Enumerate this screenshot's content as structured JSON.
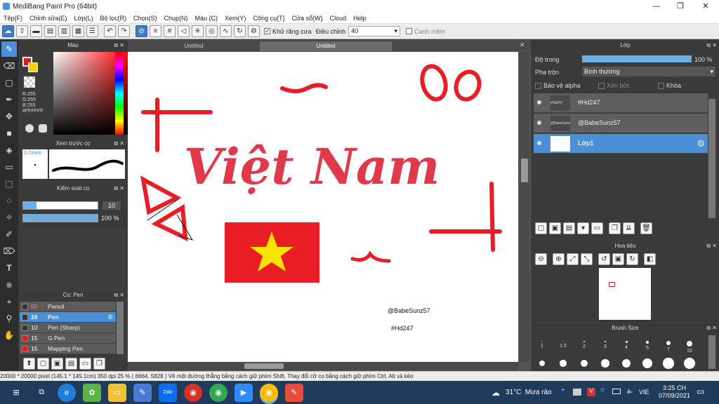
{
  "app": {
    "title": "MediBang Paint Pro (64bit)"
  },
  "menu": [
    "Tệp(F)",
    "Chỉnh sửa(E)",
    "Lớp(L)",
    "Bộ lọc(R)",
    "Chọn(S)",
    "Chụp(N)",
    "Màu (C)",
    "Xem(Y)",
    "Công cụ(T)",
    "Cửa sổ(W)",
    "Cloud",
    "Help"
  ],
  "toolbar": {
    "antialias_label": "Khử răng cưa",
    "adjust_label": "Điều chỉnh",
    "adjust_value": "40",
    "snap_label": "Canh mềm"
  },
  "color_panel": {
    "title": "Màu",
    "r": "R:255",
    "g": "G:255",
    "b": "B:255",
    "hex": "#FFFFFF",
    "primary": "#e8151b",
    "secondary": "#f5d300"
  },
  "brush_preview": {
    "title": "Xem trước cọ",
    "size": "0.73mm"
  },
  "brush_control": {
    "title": "Kiểm soát cọ",
    "size_value": "10",
    "opacity_value": "100 %"
  },
  "brush_list": {
    "title": "Cọ: Pen",
    "items": [
      {
        "size": "50",
        "name": "Pencil",
        "color": "#333333",
        "selected": false
      },
      {
        "size": "10",
        "name": "Pen",
        "color": "#333333",
        "selected": true
      },
      {
        "size": "10",
        "name": "Pen (Sharp)",
        "color": "#333333",
        "selected": false
      },
      {
        "size": "15",
        "name": "G Pen",
        "color": "#e8151b",
        "selected": false
      },
      {
        "size": "15",
        "name": "Mapping Pen",
        "color": "#e8151b",
        "selected": false
      }
    ]
  },
  "tabs": [
    "Untitled",
    "Untitled"
  ],
  "canvas": {
    "watermark1": "@BabeSunz57",
    "watermark2": "#Hd247",
    "text_large": "Việt Nam"
  },
  "layers": {
    "title": "Lớp",
    "opacity_label": "Độ trong",
    "opacity_value": "100 %",
    "blend_label": "Pha trộn",
    "blend_value": "Bình thường",
    "protect_alpha": "Bảo vệ alpha",
    "clipping": "Xén bớt",
    "lock": "Khóa",
    "items": [
      {
        "name": "#Hd247",
        "thumb": "#Hd247",
        "selected": false
      },
      {
        "name": "@BabeSunz57",
        "thumb": "@BabeSunz57",
        "selected": false
      },
      {
        "name": "Lớp1",
        "thumb": "",
        "selected": true
      }
    ]
  },
  "navigator": {
    "title": "Hoa tiêu"
  },
  "brush_size": {
    "title": "Brush Size",
    "sizes": [
      "1",
      "1.5",
      "2",
      "3",
      "4",
      "5",
      "7",
      "10"
    ]
  },
  "status": {
    "text": "20000 * 20000 pixel   (145.1 * 145.1cm)   350 dpi   25 %   ( 6664, 5828 )   Vẽ một đường thẳng bằng cách giữ phím Shift, Thay đổi cỡ cọ bằng cách giữ phím Ctrl, Alt và kéo"
  },
  "taskbar": {
    "weather": "31°C  Mưa rào",
    "lang": "VIE",
    "time": "3:25 CH",
    "date": "07/09/2021"
  }
}
